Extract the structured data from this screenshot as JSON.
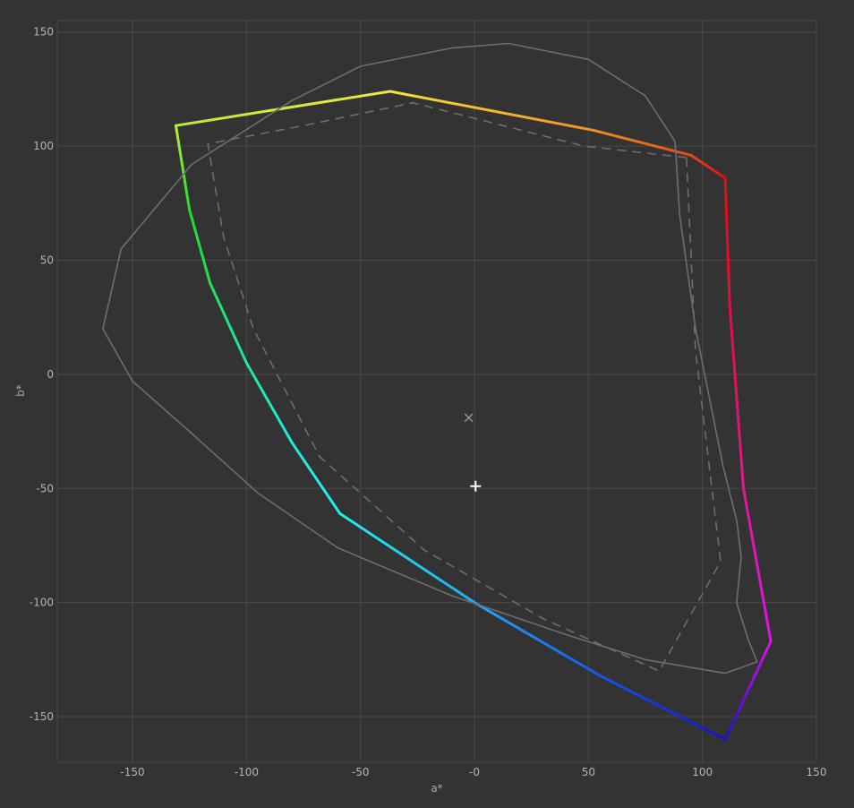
{
  "chart_data": {
    "type": "line",
    "title": "",
    "xlabel": "a*",
    "ylabel": "b*",
    "xlim": [
      -183,
      150
    ],
    "ylim": [
      -170,
      155
    ],
    "xticks": [
      -150,
      -100,
      -50,
      0,
      50,
      100,
      150
    ],
    "yticks": [
      150,
      100,
      50,
      0,
      -50,
      -100,
      -150
    ],
    "xtick_labels": [
      "-150",
      "-100",
      "-50",
      "-0",
      "50",
      "100",
      "150"
    ],
    "ytick_labels": [
      "150",
      "100",
      "50",
      "0",
      "-50",
      "-100",
      "-150"
    ],
    "grid": true,
    "colors": {
      "background": "#333333",
      "grid": "#4a4a4a",
      "reference": "#6e6e6e",
      "markers": "#a0a0a0",
      "crosshair": "#ffffff"
    },
    "series": [
      {
        "style": "solid-gradient",
        "points": [
          [
            110,
            86
          ],
          [
            95,
            96
          ],
          [
            52,
            107
          ],
          [
            -37,
            124
          ],
          [
            -131,
            109
          ],
          [
            -125,
            72
          ],
          [
            -116,
            40
          ],
          [
            -100,
            5
          ],
          [
            -80,
            -30
          ],
          [
            -59,
            -61
          ],
          [
            0,
            -100
          ],
          [
            55,
            -132
          ],
          [
            110,
            -160
          ],
          [
            130,
            -117
          ],
          [
            118,
            -50
          ],
          [
            112,
            30
          ],
          [
            110,
            86
          ]
        ],
        "colors": [
          "#dd1010",
          "#e44a15",
          "#f09020",
          "#f4e43a",
          "#b9ee37",
          "#22dd2a",
          "#23e060",
          "#1ee6a6",
          "#20ecd8",
          "#22f2ee",
          "#22aaf5",
          "#1555ee",
          "#1a10d0",
          "#e010e8",
          "#e01890",
          "#e01040",
          "#dd1010"
        ]
      },
      {
        "style": "dashed",
        "points": [
          [
            93,
            95
          ],
          [
            48,
            100
          ],
          [
            -27,
            119
          ],
          [
            -75,
            109
          ],
          [
            -117,
            101
          ],
          [
            -110,
            60
          ],
          [
            -97,
            20
          ],
          [
            -68,
            -36
          ],
          [
            -22,
            -77
          ],
          [
            30,
            -107
          ],
          [
            81,
            -130
          ],
          [
            108,
            -82
          ],
          [
            97,
            10
          ],
          [
            93,
            95
          ]
        ]
      },
      {
        "style": "solid-thin",
        "points": [
          [
            -163,
            20
          ],
          [
            -155,
            55
          ],
          [
            -124,
            92
          ],
          [
            -80,
            120
          ],
          [
            -50,
            135
          ],
          [
            -10,
            143
          ],
          [
            15,
            145
          ],
          [
            50,
            138
          ],
          [
            75,
            122
          ],
          [
            88,
            102
          ],
          [
            90,
            70
          ],
          [
            97,
            20
          ],
          [
            109,
            -40
          ],
          [
            115,
            -64
          ],
          [
            117,
            -80
          ],
          [
            115,
            -100
          ],
          [
            120,
            -116
          ],
          [
            124,
            -126
          ],
          [
            110,
            -131
          ],
          [
            75,
            -125
          ],
          [
            40,
            -114
          ],
          [
            -10,
            -97
          ],
          [
            -60,
            -76
          ],
          [
            -95,
            -52
          ],
          [
            -125,
            -25
          ],
          [
            -150,
            -3
          ],
          [
            -163,
            20
          ]
        ]
      }
    ],
    "markers": [
      {
        "kind": "x",
        "a": -2.5,
        "b": -19
      },
      {
        "kind": "plus",
        "a": 0.5,
        "b": -49
      }
    ]
  }
}
